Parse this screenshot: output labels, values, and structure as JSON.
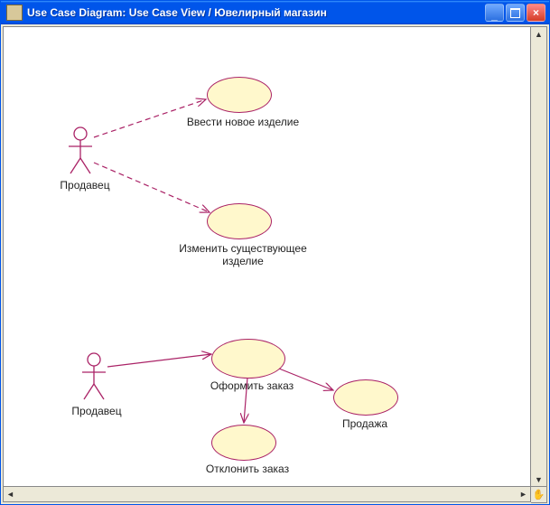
{
  "window": {
    "title": "Use Case Diagram: Use Case View / Ювелирный магазин",
    "minimize_glyph": "_",
    "close_glyph": "×"
  },
  "diagram": {
    "actors": [
      {
        "id": "actor-top",
        "label": "Продавец"
      },
      {
        "id": "actor-bottom",
        "label": "Продавец"
      }
    ],
    "usecases": [
      {
        "id": "uc-new-item",
        "label": "Ввести новое изделие"
      },
      {
        "id": "uc-edit-item",
        "label": "Изменить существующее\nизделие"
      },
      {
        "id": "uc-order",
        "label": "Оформить заказ"
      },
      {
        "id": "uc-sale",
        "label": "Продажа"
      },
      {
        "id": "uc-reject",
        "label": "Отклонить заказ"
      }
    ],
    "associations": [
      {
        "from": "actor-top",
        "to": "uc-new-item"
      },
      {
        "from": "actor-top",
        "to": "uc-edit-item"
      },
      {
        "from": "actor-bottom",
        "to": "uc-order"
      },
      {
        "from": "uc-order",
        "to": "uc-sale"
      },
      {
        "from": "uc-order",
        "to": "uc-reject"
      }
    ]
  },
  "chart_data": {
    "type": "diagram",
    "notation": "UML Use Case",
    "title": "Use Case View / Ювелирный магазин",
    "actors": [
      "Продавец",
      "Продавец"
    ],
    "usecases": [
      "Ввести новое изделие",
      "Изменить существующее изделие",
      "Оформить заказ",
      "Продажа",
      "Отклонить заказ"
    ],
    "edges": [
      [
        "Продавец",
        "Ввести новое изделие"
      ],
      [
        "Продавец",
        "Изменить существующее изделие"
      ],
      [
        "Продавец",
        "Оформить заказ"
      ],
      [
        "Оформить заказ",
        "Продажа"
      ],
      [
        "Оформить заказ",
        "Отклонить заказ"
      ]
    ]
  }
}
